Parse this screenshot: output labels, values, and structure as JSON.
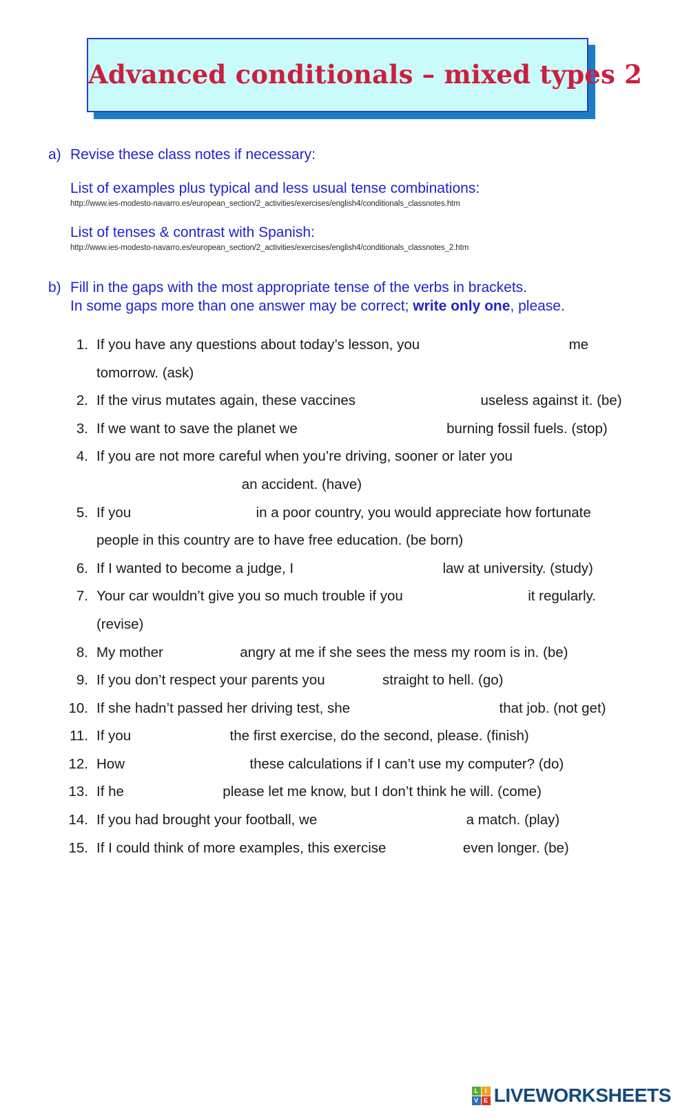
{
  "title": {
    "text": "Advanced conditionals – mixed types 2",
    "color": "#cc1f3e",
    "box_bg": "#c9fbfb",
    "box_border": "#2a3fc4",
    "shadow_color": "#1b7ec4"
  },
  "section_a": {
    "marker": "a)",
    "instruction": "Revise these class notes if necessary:",
    "notes": [
      {
        "title": "List of examples plus typical and less usual tense combinations:",
        "url": "http://www.ies-modesto-navarro.es/european_section/2_activities/exercises/english4/conditionals_classnotes.htm"
      },
      {
        "title": "List of tenses & contrast with Spanish:",
        "url": "http://www.ies-modesto-navarro.es/european_section/2_activities/exercises/english4/conditionals_classnotes_2.htm"
      }
    ]
  },
  "section_b": {
    "marker": "b)",
    "line1": "Fill in the gaps with the most appropriate tense of the verbs in brackets.",
    "line2_before": "In some gaps more than one answer may be correct; ",
    "line2_bold": "write only one",
    "line2_after": ", please.",
    "heading_color": "#2222cc"
  },
  "exercises": [
    {
      "number": "1.",
      "before": "If you have any questions about today’s lesson, you",
      "gap": "gap-xl",
      "after": "me tomorrow. (ask)"
    },
    {
      "number": "2.",
      "before": "If the virus mutates again, these vaccines",
      "gap": "gap-lg",
      "after": "useless against it. (be)"
    },
    {
      "number": "3.",
      "before": "If we want to save the planet we",
      "gap": "gap-xl",
      "after": "burning fossil fuels. (stop)"
    },
    {
      "number": "4.",
      "before": "If you are not more careful when you’re driving, sooner or later you",
      "gap": "gap-xl",
      "after": "an accident. (have)"
    },
    {
      "number": "5.",
      "before": "If you",
      "gap": "gap-lg",
      "after": "in a poor country, you would appreciate how fortunate people in this country are to have free education. (be born)"
    },
    {
      "number": "6.",
      "before": "If I wanted to become a judge, I",
      "gap": "gap-xl",
      "after": "law at university. (study)"
    },
    {
      "number": "7.",
      "before": "Your car wouldn’t give you so much trouble if you",
      "gap": "gap-lg",
      "after": "it regularly. (revise)"
    },
    {
      "number": "8.",
      "before": "My mother",
      "gap": "gap-sm",
      "after": "angry at me if she sees the mess my room is in. (be)"
    },
    {
      "number": "9.",
      "before": "If you don’t respect your parents you",
      "gap": "gap-xs",
      "after": "straight to hell. (go)"
    },
    {
      "number": "10.",
      "before": "If she hadn’t passed her driving test, she",
      "gap": "gap-xl",
      "after": "that job. (not get)"
    },
    {
      "number": "11.",
      "before": "If you",
      "gap": "gap-md",
      "after": "the first exercise, do the second, please. (finish)"
    },
    {
      "number": "12.",
      "before": "How",
      "gap": "gap-lg",
      "after": "these calculations if I can’t use my computer? (do)"
    },
    {
      "number": "13.",
      "before": "If he",
      "gap": "gap-md",
      "after": "please let me know, but I don’t think he will. (come)"
    },
    {
      "number": "14.",
      "before": "If you had brought your football, we",
      "gap": "gap-xl",
      "after": "a match. (play)"
    },
    {
      "number": "15.",
      "before": "If I could think of more examples, this exercise",
      "gap": "gap-sm",
      "after": "even longer. (be)"
    }
  ],
  "footer": {
    "logo_tiles": [
      "L",
      "I",
      "V",
      "E"
    ],
    "logo_word": "LIVEWORKSHEETS",
    "logo_word_color": "#14497d"
  }
}
